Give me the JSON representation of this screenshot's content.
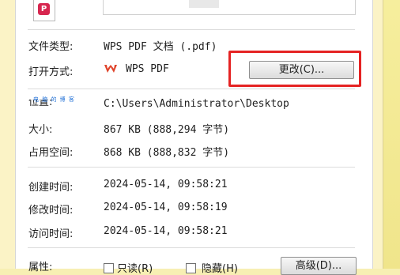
{
  "file": {
    "icon_glyph": "P",
    "icon_name": "wps-pdf-file-icon",
    "icon_color": "#d7264f"
  },
  "details": {
    "file_type": {
      "label": "文件类型:",
      "value": "WPS PDF 文档 (.pdf)"
    },
    "open_with": {
      "label": "打开方式:",
      "app_name": "WPS PDF",
      "app_icon": "wps-logo-icon",
      "change_button": "更改(C)..."
    },
    "location": {
      "label": "位置:",
      "value": "C:\\Users\\Administrator\\Desktop"
    },
    "size": {
      "label": "大小:",
      "value": "867 KB (888,294 字节)"
    },
    "size_on_disk": {
      "label": "占用空间:",
      "value": "868 KB (888,832 字节)"
    },
    "created": {
      "label": "创建时间:",
      "value": "2024-05-14, 09:58:21"
    },
    "modified": {
      "label": "修改时间:",
      "value": "2024-05-14, 09:58:19"
    },
    "accessed": {
      "label": "访问时间:",
      "value": "2024-05-14, 09:58:21"
    }
  },
  "attributes": {
    "label": "属性:",
    "readonly": "只读(R)",
    "hidden": "隐藏(H)",
    "advanced_button": "高级(D)..."
  },
  "watermark": "电 脑 的 博 客",
  "colors": {
    "highlight": "#e52323",
    "watermark": "#1f6fd6",
    "background": "#f7efb3"
  }
}
